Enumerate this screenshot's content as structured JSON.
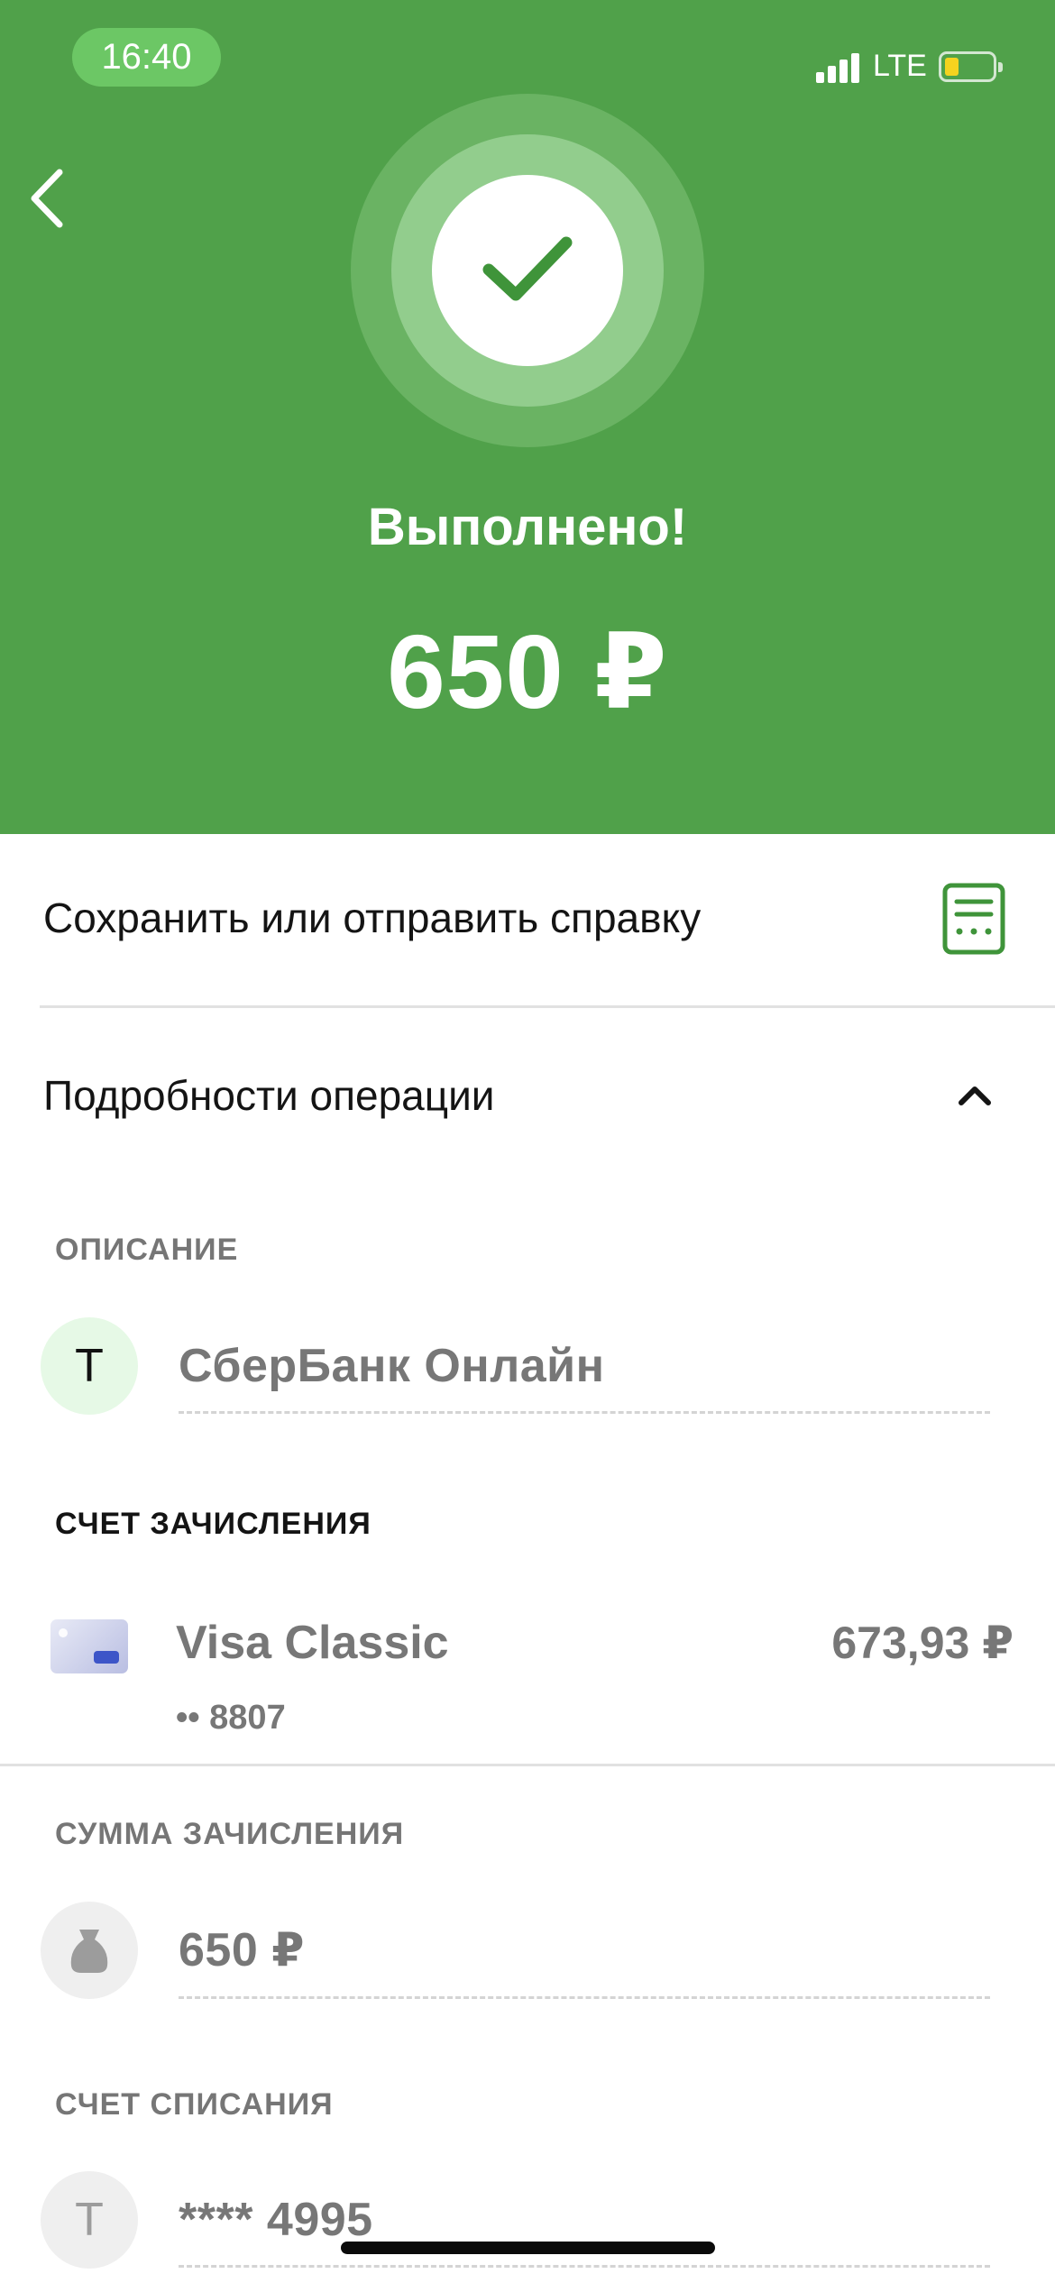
{
  "status_bar": {
    "time": "16:40",
    "network": "LTE"
  },
  "header": {
    "status_title": "Выполнено!",
    "amount": "650 ₽"
  },
  "actions": {
    "save_or_send": "Сохранить или отправить справку",
    "details_toggle": "Подробности операции"
  },
  "details": {
    "description": {
      "label": "ОПИСАНИЕ",
      "avatar_letter": "Т",
      "value": "СберБанк Онлайн"
    },
    "credit_account": {
      "label": "СЧЕТ ЗАЧИСЛЕНИЯ",
      "card_name": "Visa Classic",
      "card_mask": "•• 8807",
      "balance": "673,93 ₽"
    },
    "credit_amount": {
      "label": "СУММА ЗАЧИСЛЕНИЯ",
      "value": "650 ₽"
    },
    "debit_account": {
      "label": "СЧЕТ СПИСАНИЯ",
      "avatar_letter": "Т",
      "value": "**** 4995"
    }
  },
  "colors": {
    "brand_green": "#50a14a",
    "battery_level": "#f5d31f"
  },
  "icons": [
    "back-chevron-icon",
    "success-check-icon",
    "receipt-document-icon",
    "chevron-up-icon",
    "visa-card-icon",
    "money-bag-icon"
  ]
}
